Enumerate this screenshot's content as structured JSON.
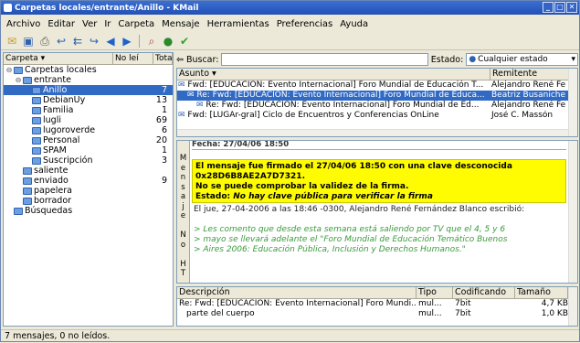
{
  "window": {
    "title": "Carpetas locales/entrante/Anillo - KMail"
  },
  "menu": [
    "Archivo",
    "Editar",
    "Ver",
    "Ir",
    "Carpeta",
    "Mensaje",
    "Herramientas",
    "Preferencias",
    "Ayuda"
  ],
  "folders": {
    "header_name": "Carpeta",
    "header_unread": "No leí",
    "header_total": "Tota",
    "items": [
      {
        "label": "Carpetas locales",
        "count": "",
        "indent": 0,
        "sel": false
      },
      {
        "label": "entrante",
        "count": "",
        "indent": 1,
        "sel": false
      },
      {
        "label": "Anillo",
        "count": "7",
        "indent": 2,
        "sel": true
      },
      {
        "label": "DebianUy",
        "count": "13",
        "indent": 2,
        "sel": false
      },
      {
        "label": "Familia",
        "count": "1",
        "indent": 2,
        "sel": false
      },
      {
        "label": "lugli",
        "count": "69",
        "indent": 2,
        "sel": false
      },
      {
        "label": "lugoroverde",
        "count": "6",
        "indent": 2,
        "sel": false
      },
      {
        "label": "Personal",
        "count": "20",
        "indent": 2,
        "sel": false
      },
      {
        "label": "SPAM",
        "count": "1",
        "indent": 2,
        "sel": false
      },
      {
        "label": "Suscripción",
        "count": "3",
        "indent": 2,
        "sel": false
      },
      {
        "label": "saliente",
        "count": "",
        "indent": 1,
        "sel": false
      },
      {
        "label": "enviado",
        "count": "9",
        "indent": 1,
        "sel": false
      },
      {
        "label": "papelera",
        "count": "",
        "indent": 1,
        "sel": false
      },
      {
        "label": "borrador",
        "count": "",
        "indent": 1,
        "sel": false
      },
      {
        "label": "Búsquedas",
        "count": "",
        "indent": 0,
        "sel": false
      }
    ]
  },
  "search": {
    "label": "Buscar:",
    "state_label": "Estado:",
    "state_value": "Cualquier estado"
  },
  "messages": {
    "col_subject": "Asunto",
    "col_sender": "Remitente",
    "rows": [
      {
        "subject": "Fwd: [EDUCACION: Evento Internacional] Foro Mundial de Educación T...",
        "sender": "Alejandro René Fe",
        "indent": 0,
        "sel": false
      },
      {
        "subject": "Re: Fwd: [EDUCACION: Evento Internacional] Foro Mundial de Educa...",
        "sender": "Beatriz Busaniche",
        "indent": 1,
        "sel": true
      },
      {
        "subject": "Re: Fwd: [EDUCACION: Evento Internacional] Foro Mundial de Ed...",
        "sender": "Alejandro René Fe",
        "indent": 2,
        "sel": false
      },
      {
        "subject": "Fwd: [LUGAr-gral] Ciclo de Encuentros y Conferencias OnLine",
        "sender": "José C. Massón",
        "indent": 0,
        "sel": false
      }
    ]
  },
  "reader": {
    "side_label": "Mensaje No HT",
    "date_header": "Fecha: 27/04/06 18:50",
    "sig_line1": "El mensaje fue firmado el 27/04/06 18:50 con una clave desconocida",
    "sig_line2": "0x28D6B8AE2A7D7321.",
    "sig_line3": "No se puede comprobar la validez de la firma.",
    "sig_status_label": "Estado:",
    "sig_status_value": "No hay clave pública para verificar la firma",
    "intro": "El jue, 27-04-2006 a las 18:46 -0300, Alejandro René Fernández Blanco escribió:",
    "quote1": "> Les comento que desde esta semana está saliendo por TV que el 4, 5 y 6",
    "quote2": "> mayo se llevará adelante el \"Foro Mundial de Educación Temático Buenos",
    "quote3": "> Aires 2006: Educación Pública, Inclusión y Derechos Humanos.\""
  },
  "parts": {
    "col_desc": "Descripción",
    "col_type": "Tipo",
    "col_enc": "Codificando",
    "col_size": "Tamaño",
    "rows": [
      {
        "desc": "Re: Fwd: [EDUCACION: Evento Internacional] Foro Mundi...",
        "type": "mul...",
        "enc": "7bit",
        "size": "4,7 KB"
      },
      {
        "desc": "parte del cuerpo",
        "type": "mul...",
        "enc": "7bit",
        "size": "1,0 KB"
      }
    ]
  },
  "status": {
    "text": "7 mensajes, 0 no leídos."
  }
}
